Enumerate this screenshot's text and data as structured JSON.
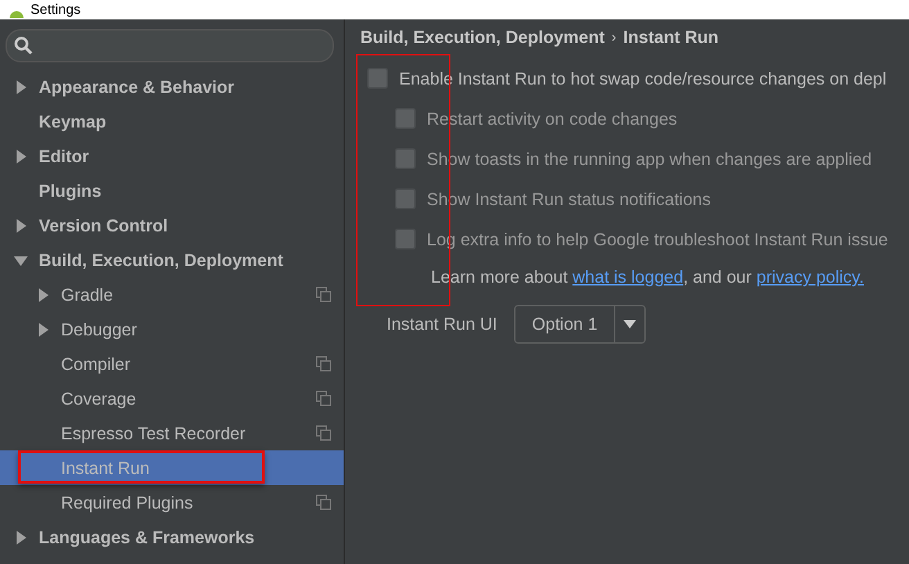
{
  "window": {
    "title": "Settings"
  },
  "sidebar": {
    "items": [
      {
        "label": "Appearance & Behavior",
        "expanded": false,
        "selected": false,
        "copy_icon": false
      },
      {
        "label": "Keymap",
        "selected": false,
        "copy_icon": false
      },
      {
        "label": "Editor",
        "expanded": false,
        "selected": false,
        "copy_icon": false
      },
      {
        "label": "Plugins",
        "selected": false,
        "copy_icon": false
      },
      {
        "label": "Version Control",
        "expanded": false,
        "selected": false,
        "copy_icon": false
      },
      {
        "label": "Build, Execution, Deployment",
        "expanded": true,
        "selected": false,
        "copy_icon": false,
        "children": [
          {
            "label": "Gradle",
            "expanded": false,
            "selected": false,
            "copy_icon": true
          },
          {
            "label": "Debugger",
            "expanded": false,
            "selected": false,
            "copy_icon": false
          },
          {
            "label": "Compiler",
            "selected": false,
            "copy_icon": true
          },
          {
            "label": "Coverage",
            "selected": false,
            "copy_icon": true
          },
          {
            "label": "Espresso Test Recorder",
            "selected": false,
            "copy_icon": true
          },
          {
            "label": "Instant Run",
            "selected": true,
            "copy_icon": false
          },
          {
            "label": "Required Plugins",
            "selected": false,
            "copy_icon": true
          }
        ]
      },
      {
        "label": "Languages & Frameworks",
        "expanded": false,
        "selected": false,
        "copy_icon": false
      }
    ]
  },
  "breadcrumb": {
    "parent": "Build, Execution, Deployment",
    "separator": "›",
    "current": "Instant Run"
  },
  "options": [
    {
      "label": "Enable Instant Run to hot swap code/resource changes on depl",
      "checked": false,
      "children": [
        {
          "label": "Restart activity on code changes",
          "checked": false
        },
        {
          "label": "Show toasts in the running app when changes are applied",
          "checked": false
        },
        {
          "label": "Show Instant Run status notifications",
          "checked": false
        },
        {
          "label": "Log extra info to help Google troubleshoot Instant Run issue",
          "checked": false
        }
      ]
    }
  ],
  "learn_more": {
    "before": "Learn more about",
    "link1": "what is logged",
    "middle": ", and our",
    "link2": "privacy policy."
  },
  "instant_run_ui": {
    "label": "Instant Run UI",
    "value": "Option 1"
  }
}
